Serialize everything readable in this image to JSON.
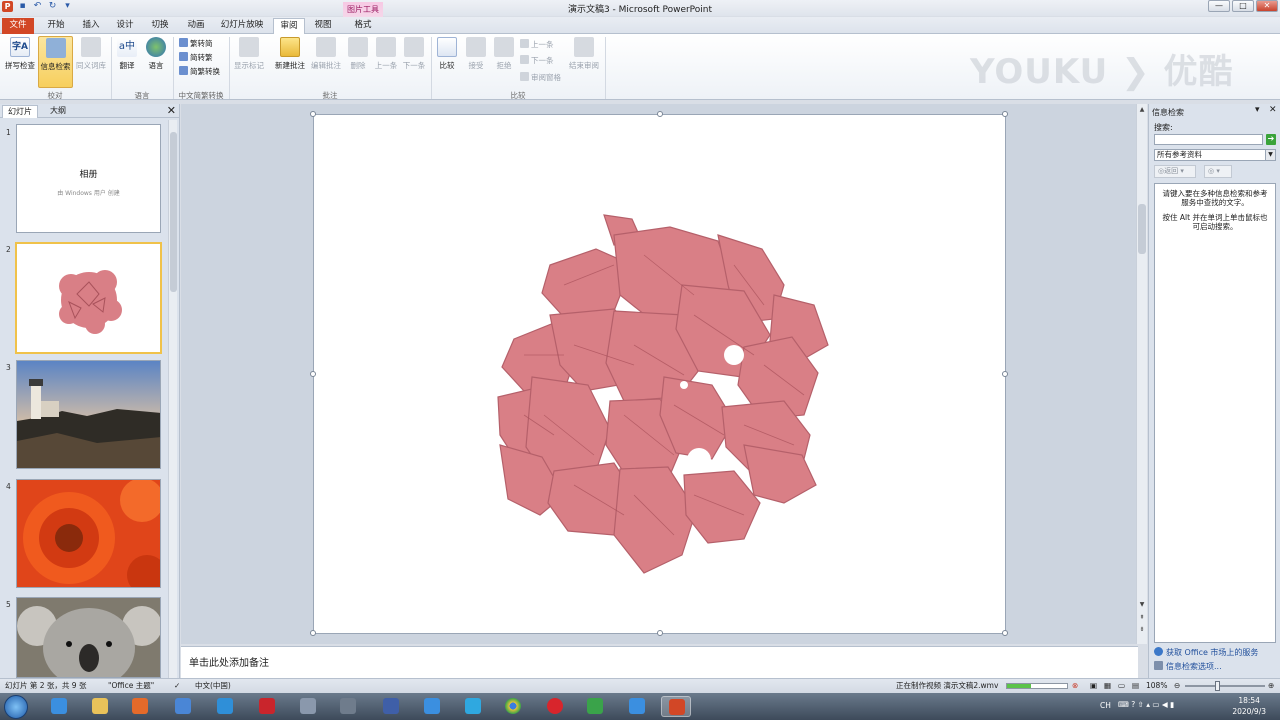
{
  "window": {
    "title": "演示文稿3 - Microsoft PowerPoint",
    "contextual_group": "图片工具",
    "controls": {
      "min": "—",
      "max": "□",
      "close": "✕"
    }
  },
  "tabs": [
    {
      "label": "文件",
      "kind": "file"
    },
    {
      "label": "开始"
    },
    {
      "label": "插入"
    },
    {
      "label": "设计"
    },
    {
      "label": "切换"
    },
    {
      "label": "动画"
    },
    {
      "label": "幻灯片放映"
    },
    {
      "label": "审阅",
      "active": true
    },
    {
      "label": "视图"
    },
    {
      "label": "格式"
    }
  ],
  "ribbon": {
    "proofing": {
      "spell": "拼写检查",
      "research": "信息检索",
      "thesaurus": "同义词库",
      "group": "校对"
    },
    "language": {
      "translate": "翻译",
      "language": "语言",
      "group": "语言"
    },
    "chinese": {
      "to_trad": "繁转简",
      "to_simp": "简转繁",
      "convert": "简繁转换",
      "group": "中文简繁转换"
    },
    "comments": {
      "show_markup": "显示标记",
      "new": "新建批注",
      "edit": "编辑批注",
      "delete": "删除",
      "prev": "上一条",
      "next": "下一条",
      "group": "批注"
    },
    "compare": {
      "compare": "比较",
      "accept": "接受",
      "reject": "拒绝",
      "prev": "上一条",
      "next": "下一条",
      "review_pane": "审阅窗格",
      "end_review": "结束审阅",
      "group": "比较"
    },
    "watermark": "YOUKU ❯ 优酷"
  },
  "left_pane": {
    "tabs": [
      "幻灯片",
      "大纲"
    ],
    "close": "✕",
    "slides": [
      {
        "num": "1",
        "title": "相册",
        "subtitle": "由 Windows 用户 创建"
      },
      {
        "num": "2"
      },
      {
        "num": "3"
      },
      {
        "num": "4"
      },
      {
        "num": "5"
      }
    ]
  },
  "notes_placeholder": "单击此处添加备注",
  "research_pane": {
    "title": "信息检索",
    "search_label": "搜索:",
    "search_value": "",
    "source": "所有参考资料",
    "back": "◎返回",
    "forward": "◎",
    "body_1": "请键入要在多种信息检索和参考服务中查找的文字。",
    "body_2": "按住 Alt 并在单词上单击鼠标也可启动搜索。",
    "link_1": "获取 Office 市场上的服务",
    "link_2": "信息检索选项..."
  },
  "status": {
    "slide_info": "幻灯片 第 2 张，共 9 张",
    "theme": "\"Office 主题\"",
    "language": "中文(中国)",
    "task": "正在制作视频 演示文稿2.wmv",
    "zoom": "108%",
    "progress": 0.4
  },
  "taskbar": {
    "time": "18:54",
    "date": "2020/9/3",
    "ime": "CH"
  },
  "colors": {
    "file_tab": "#d24726",
    "flower": "#d97f86",
    "selected_thumb_border": "#f0c24a"
  }
}
